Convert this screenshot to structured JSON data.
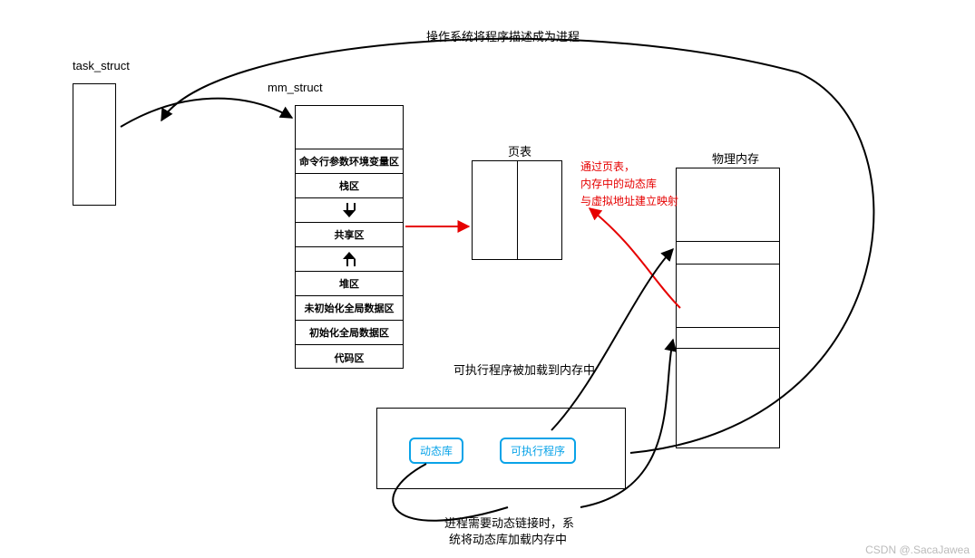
{
  "labels": {
    "task_struct": "task_struct",
    "mm_struct": "mm_struct",
    "page_table": "页表",
    "physical_mem": "物理内存",
    "os_describe": "操作系统将程序描述成为进程",
    "exec_loaded": "可执行程序被加载到内存中",
    "dyn_link_1": "进程需要动态链接时，系",
    "dyn_link_2": "统将动态库加载内存中",
    "watermark": "CSDN @.SacaJawea"
  },
  "mm_struct_cells": [
    "命令行参数环境变量区",
    "栈区",
    "__arrow_down__",
    "共享区",
    "__arrow_up__",
    "堆区",
    "未初始化全局数据区",
    "初始化全局数据区",
    "代码区"
  ],
  "red_text_lines": [
    "通过页表，",
    "内存中的动态库",
    "与虚拟地址建立映射"
  ],
  "disk_items": {
    "dynlib": "动态库",
    "executable": "可执行程序"
  }
}
